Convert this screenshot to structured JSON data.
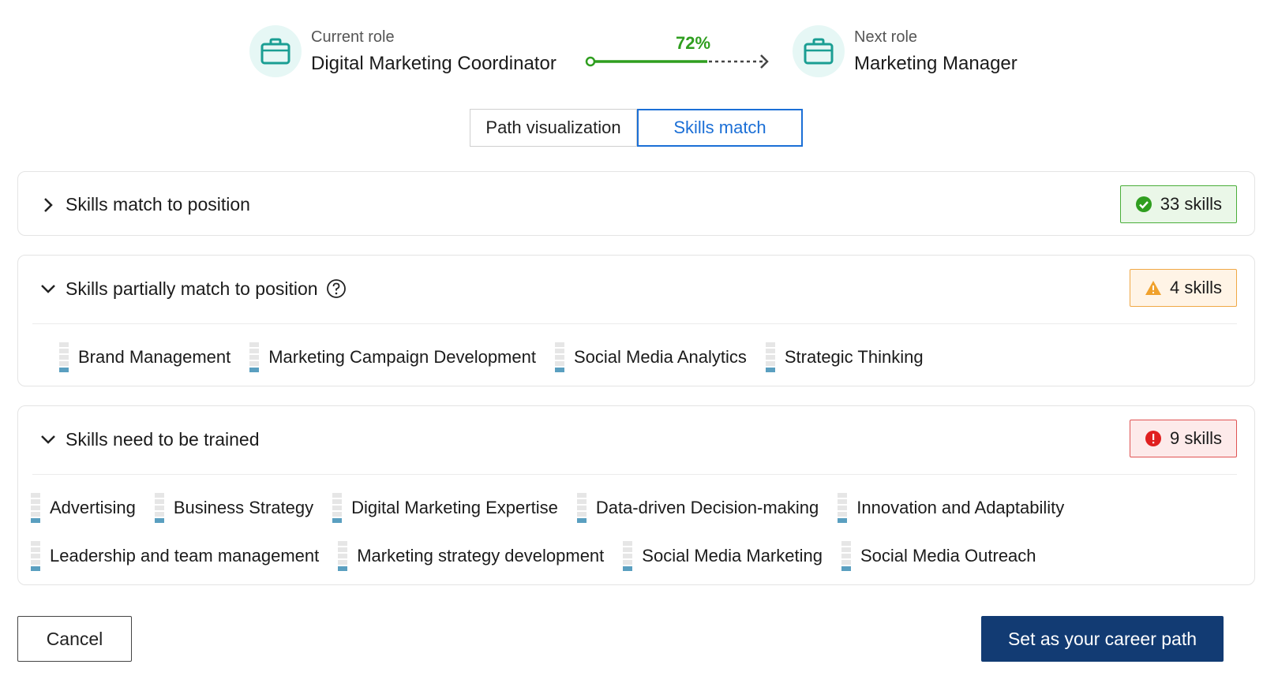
{
  "header": {
    "current_role": {
      "label": "Current role",
      "title": "Digital Marketing Coordinator",
      "icon": "briefcase-icon"
    },
    "next_role": {
      "label": "Next role",
      "title": "Marketing Manager",
      "icon": "briefcase-icon"
    },
    "progress": {
      "text": "72%",
      "value": 0.72,
      "color": "#2f9e1f"
    }
  },
  "tabs": [
    {
      "label": "Path visualization",
      "active": false
    },
    {
      "label": "Skills match",
      "active": true
    }
  ],
  "sections": {
    "match": {
      "title": "Skills match to position",
      "badge": "33 skills",
      "badge_icon": "check-circle-icon",
      "expanded": false
    },
    "partial": {
      "title": "Skills partially match to position",
      "badge": "4 skills",
      "badge_icon": "warning-icon",
      "expanded": true,
      "skills": [
        "Brand Management",
        "Marketing Campaign Development",
        "Social Media Analytics",
        "Strategic Thinking"
      ]
    },
    "train": {
      "title": "Skills need to be trained",
      "badge": "9 skills",
      "badge_icon": "error-circle-icon",
      "expanded": true,
      "skills_row1": [
        "Advertising",
        "Business Strategy",
        "Digital Marketing Expertise",
        "Data-driven Decision-making",
        "Innovation and Adaptability"
      ],
      "skills_row2": [
        "Leadership and team management",
        "Marketing strategy development",
        "Social Media Marketing",
        "Social Media Outreach"
      ]
    }
  },
  "footer": {
    "cancel_label": "Cancel",
    "primary_label": "Set as your career path"
  },
  "colors": {
    "accent": "#1b6fd6",
    "primary_button": "#123b73",
    "success": "#4aae3a",
    "warning": "#f0a845",
    "error": "#e05353"
  }
}
